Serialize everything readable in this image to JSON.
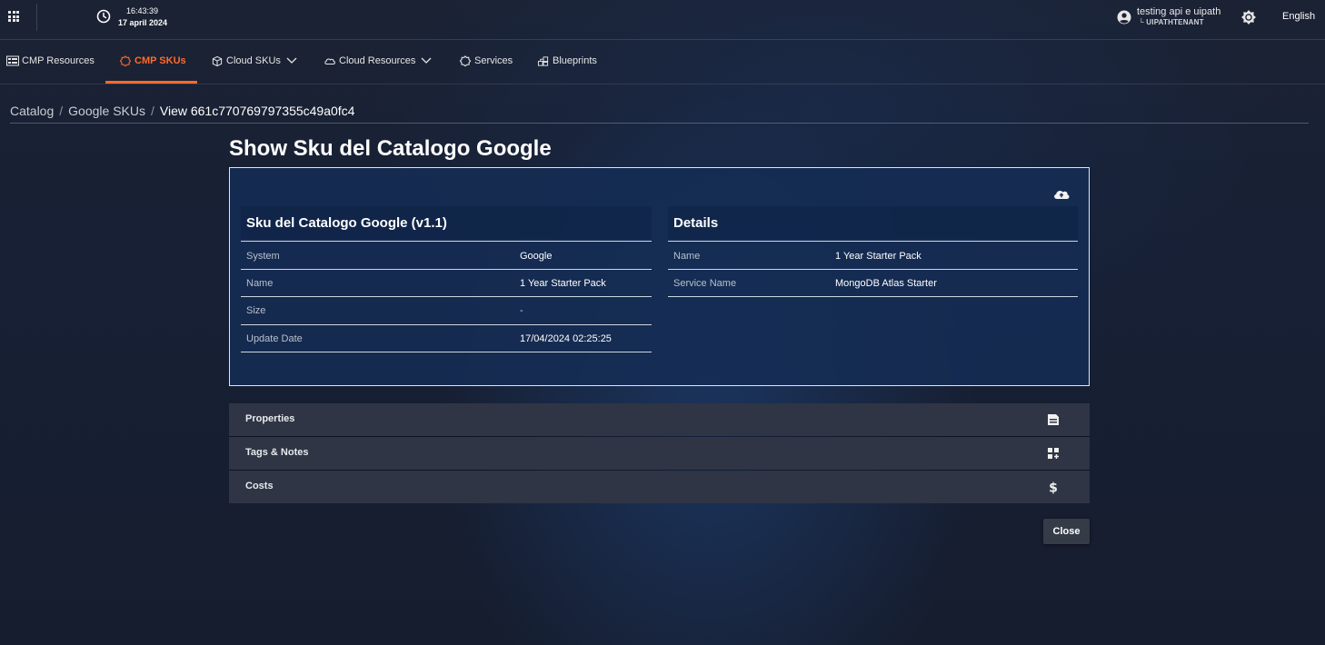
{
  "header": {
    "time": "16:43:39",
    "date": "17 april 2024",
    "user_name": "testing api e uipath",
    "user_tenant": "└ UIPATHTENANT",
    "language": "English"
  },
  "nav": {
    "tabs": [
      {
        "label": "CMP Resources",
        "icon": "list-icon"
      },
      {
        "label": "CMP SKUs",
        "icon": "gear-icon",
        "active": true
      },
      {
        "label": "Cloud SKUs",
        "icon": "box-icon",
        "dropdown": true
      },
      {
        "label": "Cloud Resources",
        "icon": "cloud-icon",
        "dropdown": true
      },
      {
        "label": "Services",
        "icon": "gear-icon"
      },
      {
        "label": "Blueprints",
        "icon": "blueprint-icon"
      }
    ],
    "accent_color": "#ff6a2b"
  },
  "breadcrumb": {
    "items": [
      "Catalog",
      "Google SKUs"
    ],
    "current": "View 661c770769797355c49a0fc4"
  },
  "page": {
    "title": "Show Sku del Catalogo Google"
  },
  "card": {
    "left": {
      "title": "Sku del Catalogo Google (v1.1)",
      "rows": [
        {
          "label": "System",
          "value": "Google"
        },
        {
          "label": "Name",
          "value": "1 Year Starter Pack"
        },
        {
          "label": "Size",
          "value": "-"
        },
        {
          "label": "Update Date",
          "value": "17/04/2024 02:25:25"
        }
      ]
    },
    "right": {
      "title": "Details",
      "rows": [
        {
          "label": "Name",
          "value": "1 Year Starter Pack"
        },
        {
          "label": "Service Name",
          "value": "MongoDB Atlas Starter"
        }
      ]
    }
  },
  "accordion": [
    {
      "label": "Properties",
      "icon": "save-icon"
    },
    {
      "label": "Tags & Notes",
      "icon": "add-widget-icon"
    },
    {
      "label": "Costs",
      "icon": "dollar-icon"
    }
  ],
  "actions": {
    "close_label": "Close"
  }
}
